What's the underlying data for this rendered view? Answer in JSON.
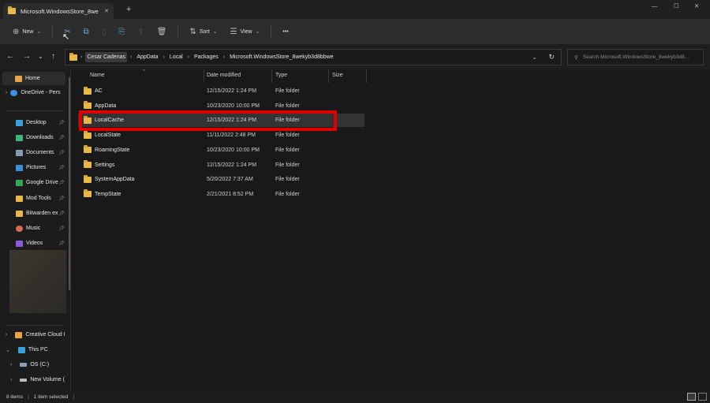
{
  "tab": {
    "title": "Microsoft.WindowsStore_8we",
    "close": "✕",
    "new_tab": "+"
  },
  "window": {
    "minimize": "—",
    "maximize": "☐",
    "close": "✕"
  },
  "toolbar": {
    "new": "New",
    "sort": "Sort",
    "view": "View",
    "more": "•••"
  },
  "address": {
    "crumbs": [
      "Cesar Cadenas",
      "AppData",
      "Local",
      "Packages",
      "Microsoft.WindowsStore_8wekyb3d8bbwe"
    ]
  },
  "search": {
    "placeholder": "Search Microsoft.WindowsStore_8wekyb3d8..."
  },
  "sidebar": {
    "items": [
      {
        "label": "Home",
        "color": "#e8a44a"
      },
      {
        "label": "OneDrive - Pers",
        "color": "#3a8fd9"
      },
      {
        "label": "Desktop",
        "color": "#3aa0e0"
      },
      {
        "label": "Downloads",
        "color": "#3fb57a"
      },
      {
        "label": "Documents",
        "color": "#8a9ab0"
      },
      {
        "label": "Pictures",
        "color": "#3a8fd9"
      },
      {
        "label": "Google Drive",
        "color": "#34a853"
      },
      {
        "label": "Mod Tools",
        "color": "#e8b949"
      },
      {
        "label": "Bitwarden ex",
        "color": "#e8b949"
      },
      {
        "label": "Music",
        "color": "#d96a5a"
      },
      {
        "label": "Videos",
        "color": "#8a5ad9"
      },
      {
        "label": "Creative Cloud I",
        "color": "#e8a44a"
      },
      {
        "label": "This PC",
        "color": "#3aa0e0"
      },
      {
        "label": "OS (C:)",
        "color": "#8aa0b8"
      },
      {
        "label": "New Volume (",
        "color": "#bbbbbb"
      }
    ]
  },
  "columns": {
    "name": "Name",
    "date": "Date modified",
    "type": "Type",
    "size": "Size"
  },
  "files": [
    {
      "name": "AC",
      "date": "12/15/2022 1:24 PM",
      "type": "File folder"
    },
    {
      "name": "AppData",
      "date": "10/23/2020 10:00 PM",
      "type": "File folder"
    },
    {
      "name": "LocalCache",
      "date": "12/15/2022 1:24 PM",
      "type": "File folder"
    },
    {
      "name": "LocalState",
      "date": "11/11/2022 2:48 PM",
      "type": "File folder"
    },
    {
      "name": "RoamingState",
      "date": "10/23/2020 10:00 PM",
      "type": "File folder"
    },
    {
      "name": "Settings",
      "date": "12/15/2022 1:24 PM",
      "type": "File folder"
    },
    {
      "name": "SystemAppData",
      "date": "5/20/2022 7:37 AM",
      "type": "File folder"
    },
    {
      "name": "TempState",
      "date": "2/21/2021 8:52 PM",
      "type": "File folder"
    }
  ],
  "status": {
    "count": "8 items",
    "selected": "1 item selected"
  }
}
